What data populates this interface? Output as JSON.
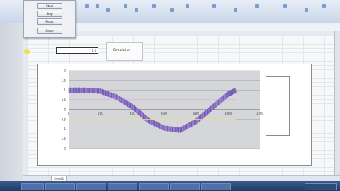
{
  "ribbon": {
    "group_labels": [
      "",
      "",
      "",
      "",
      "",
      "",
      ""
    ]
  },
  "dialog": {
    "buttons": [
      "Start",
      "Stop",
      "Reset",
      "Close"
    ]
  },
  "sheet": {
    "input_value": "1.0",
    "button_label": "Simulation",
    "sheet_tab": "Sheet1"
  },
  "chart_data": {
    "type": "line",
    "title": "",
    "xlabel": "",
    "ylabel": "",
    "xlim": [
      0,
      1200
    ],
    "ylim": [
      -2,
      2
    ],
    "x_ticks": [
      "0",
      "200",
      "400",
      "600",
      "800",
      "1000",
      "1200"
    ],
    "y_ticks": [
      "2",
      "1.5",
      "1",
      "0.5",
      "0",
      "-0.5",
      "-1",
      "-1.5",
      "-2"
    ],
    "grid": true,
    "legend_position": "right",
    "series": [
      {
        "name": "",
        "color": "#8a6fc8",
        "points": [
          [
            0,
            1.0
          ],
          [
            100,
            1.0
          ],
          [
            200,
            0.95
          ],
          [
            300,
            0.65
          ],
          [
            400,
            0.15
          ],
          [
            500,
            -0.55
          ],
          [
            600,
            -0.95
          ],
          [
            700,
            -1.05
          ],
          [
            800,
            -0.6
          ],
          [
            900,
            0.1
          ],
          [
            1000,
            0.8
          ],
          [
            1050,
            1.0
          ]
        ]
      },
      {
        "name": "",
        "color": "#e07adb",
        "points": [
          [
            0,
            0.5
          ],
          [
            1050,
            0.5
          ]
        ]
      },
      {
        "name": "",
        "color": "#e8e07a",
        "points": [
          [
            0,
            -0.5
          ],
          [
            1050,
            -0.5
          ]
        ]
      }
    ],
    "legend_labels": [
      "",
      "",
      ""
    ],
    "legend_colors": [
      "#8a6fc8",
      "#e07adb",
      "#e8e07a"
    ]
  },
  "colors": {
    "taskbar": "#203a66",
    "chart_bg": "#d4d6da"
  }
}
